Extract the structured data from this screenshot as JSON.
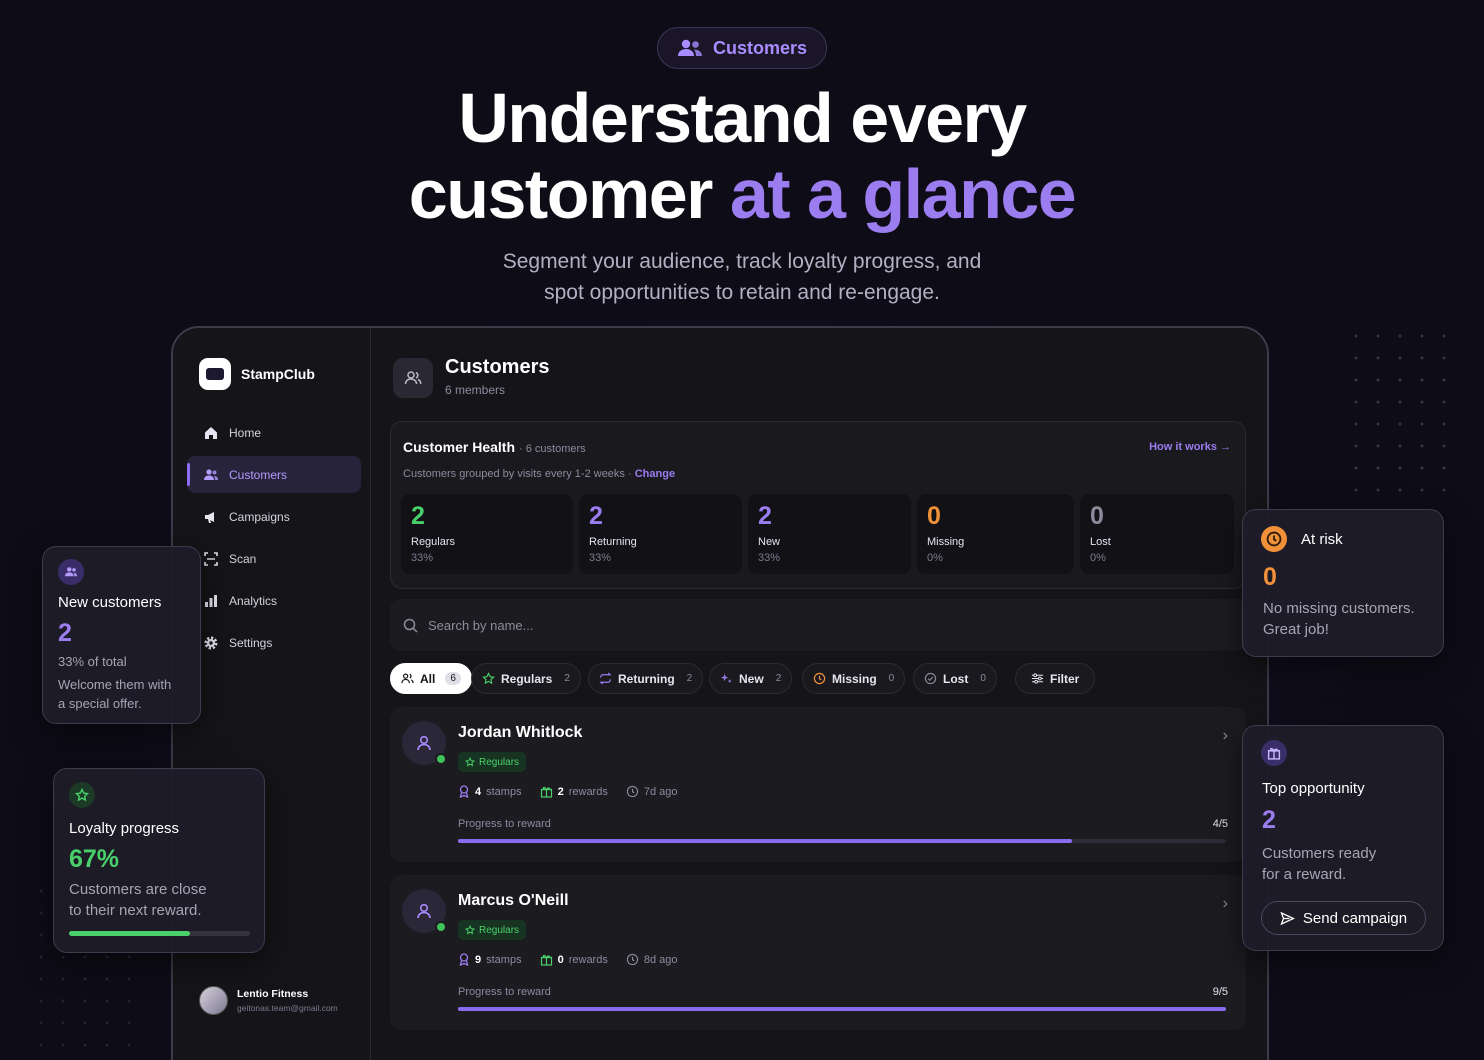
{
  "hero": {
    "pill_label": "Customers",
    "title_line1": "Understand every",
    "title_line2_plain": "customer ",
    "title_line2_accent": "at a glance",
    "subtitle_line1": "Segment your audience, track loyalty progress, and",
    "subtitle_line2": "spot opportunities to retain and re-engage."
  },
  "sidebar": {
    "brand": "StampClub",
    "items": [
      {
        "label": "Home",
        "icon": "home-icon"
      },
      {
        "label": "Customers",
        "icon": "users-icon",
        "active": true
      },
      {
        "label": "Campaigns",
        "icon": "megaphone-icon"
      },
      {
        "label": "Scan",
        "icon": "scan-icon"
      },
      {
        "label": "Analytics",
        "icon": "bar-chart-icon"
      },
      {
        "label": "Settings",
        "icon": "gear-icon"
      }
    ],
    "user": {
      "name": "Lentio Fitness",
      "email": "geitonas.team@gmail.com"
    }
  },
  "page": {
    "title": "Customers",
    "subtitle": "6 members"
  },
  "health": {
    "title": "Customer Health",
    "count": "· 6 customers",
    "how_link": "How it works →",
    "grouping": "Customers grouped by visits every 1-2 weeks ·",
    "change_link": "Change",
    "cards": [
      {
        "value": "2",
        "label": "Regulars",
        "pct": "33%",
        "color": "#4ad06a"
      },
      {
        "value": "2",
        "label": "Returning",
        "pct": "33%",
        "color": "#9b7df0"
      },
      {
        "value": "2",
        "label": "New",
        "pct": "33%",
        "color": "#9b7df0"
      },
      {
        "value": "0",
        "label": "Missing",
        "pct": "0%",
        "color": "#f0913a"
      },
      {
        "value": "0",
        "label": "Lost",
        "pct": "0%",
        "color": "#8e8a9c"
      }
    ]
  },
  "search": {
    "placeholder": "Search by name..."
  },
  "filters": {
    "chips": [
      {
        "label": "All",
        "count": "6"
      },
      {
        "label": "Regulars",
        "count": "2"
      },
      {
        "label": "Returning",
        "count": "2"
      },
      {
        "label": "New",
        "count": "2"
      },
      {
        "label": "Missing",
        "count": "0"
      },
      {
        "label": "Lost",
        "count": "0"
      }
    ],
    "filter_button": "Filter"
  },
  "customers": [
    {
      "name": "Jordan Whitlock",
      "badge": "Regulars",
      "stamps": "4",
      "stamps_label": "stamps",
      "rewards": "2",
      "rewards_label": "rewards",
      "last_visit": "7d ago",
      "progress_label": "Progress to reward",
      "progress_text": "4/5",
      "progress_fraction": 0.8
    },
    {
      "name": "Marcus O'Neill",
      "badge": "Regulars",
      "stamps": "9",
      "stamps_label": "stamps",
      "rewards": "0",
      "rewards_label": "rewards",
      "last_visit": "8d ago",
      "progress_label": "Progress to reward",
      "progress_text": "9/5",
      "progress_fraction": 1.0
    }
  ],
  "floats": {
    "new_customers": {
      "title": "New customers",
      "value": "2",
      "sub": "33% of total",
      "text_line1": "Welcome them with",
      "text_line2": "a special offer."
    },
    "loyalty": {
      "title": "Loyalty progress",
      "value": "67%",
      "text_line1": "Customers are close",
      "text_line2": "to their next reward.",
      "progress_fraction": 0.67
    },
    "at_risk": {
      "title": "At risk",
      "value": "0",
      "text_line1": "No missing customers.",
      "text_line2": "Great job!"
    },
    "top_opportunity": {
      "title": "Top opportunity",
      "value": "2",
      "text_line1": "Customers ready",
      "text_line2": "for a reward.",
      "button": "Send campaign"
    }
  }
}
